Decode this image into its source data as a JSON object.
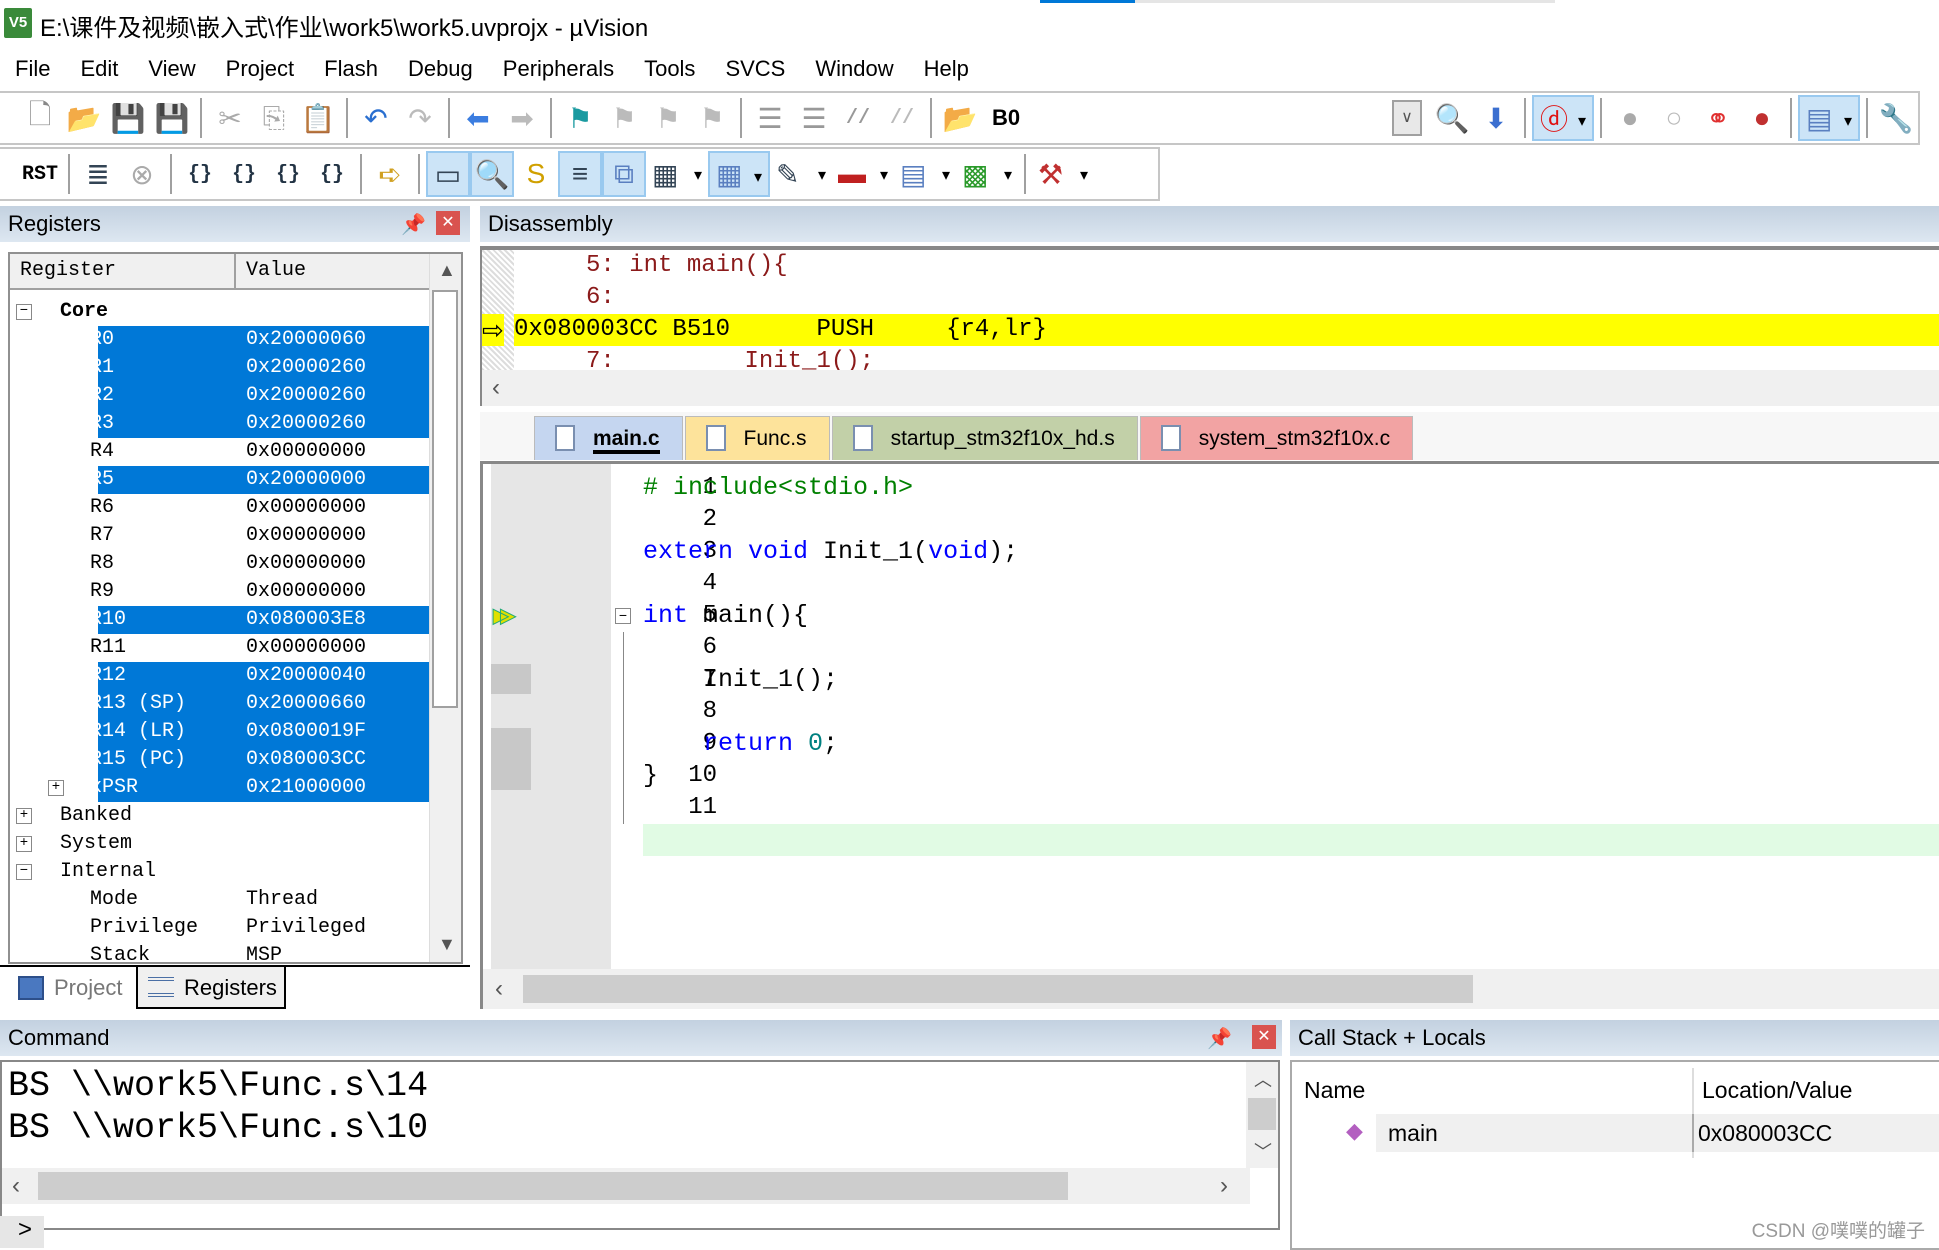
{
  "window": {
    "title": "E:\\课件及视频\\嵌入式\\作业\\work5\\work5.uvprojx - µVision",
    "logo_text": "V5"
  },
  "menu": [
    "File",
    "Edit",
    "View",
    "Project",
    "Flash",
    "Debug",
    "Peripherals",
    "Tools",
    "SVCS",
    "Window",
    "Help"
  ],
  "toolbar1": {
    "groups": [
      [
        "new-file",
        "open-file",
        "save",
        "save-all"
      ],
      [
        "cut",
        "copy",
        "paste"
      ],
      [
        "undo",
        "redo"
      ],
      [
        "navigate-back",
        "navigate-forward"
      ],
      [
        "bookmark",
        "prev-bookmark",
        "next-bookmark",
        "clear-bookmarks"
      ],
      [
        "indent",
        "unindent",
        "comment",
        "uncomment"
      ],
      [
        "find-in-files"
      ]
    ],
    "target_text": "B0",
    "right_groups": [
      [
        "find",
        "incremental-find"
      ],
      [
        "start-debug*"
      ],
      [
        "insert-breakpoint",
        "enable-breakpoint",
        "disable-breakpoints",
        "kill-breakpoints"
      ],
      [
        "window-layout*"
      ],
      [
        "configure"
      ]
    ]
  },
  "toolbar2": {
    "groups": [
      [
        "reset"
      ],
      [
        "run",
        "stop"
      ],
      [
        "step-into",
        "step-over",
        "step-out",
        "run-to-cursor"
      ],
      [
        "show-next-statement"
      ],
      [
        "command-window!",
        "disassembly-window!",
        "symbols-window",
        "registers-window!",
        "call-stack-window!",
        "watch-window>",
        "memory-window!>",
        "serial-window>",
        "analysis-window>",
        "trace-window>",
        "system-viewer>"
      ],
      [
        "toolbox>"
      ]
    ]
  },
  "registers": {
    "title": "Registers",
    "columns": [
      "Register",
      "Value"
    ],
    "rows": [
      {
        "name": "Core",
        "value": "",
        "level": 0,
        "expander": "−",
        "bold": true
      },
      {
        "name": "R0",
        "value": "0x20000060",
        "level": 1,
        "hl": true
      },
      {
        "name": "R1",
        "value": "0x20000260",
        "level": 1,
        "hl": true
      },
      {
        "name": "R2",
        "value": "0x20000260",
        "level": 1,
        "hl": true
      },
      {
        "name": "R3",
        "value": "0x20000260",
        "level": 1,
        "hl": true
      },
      {
        "name": "R4",
        "value": "0x00000000",
        "level": 1
      },
      {
        "name": "R5",
        "value": "0x20000000",
        "level": 1,
        "hl": true
      },
      {
        "name": "R6",
        "value": "0x00000000",
        "level": 1
      },
      {
        "name": "R7",
        "value": "0x00000000",
        "level": 1
      },
      {
        "name": "R8",
        "value": "0x00000000",
        "level": 1
      },
      {
        "name": "R9",
        "value": "0x00000000",
        "level": 1
      },
      {
        "name": "R10",
        "value": "0x080003E8",
        "level": 1,
        "hl": true
      },
      {
        "name": "R11",
        "value": "0x00000000",
        "level": 1
      },
      {
        "name": "R12",
        "value": "0x20000040",
        "level": 1,
        "hl": true
      },
      {
        "name": "R13 (SP)",
        "value": "0x20000660",
        "level": 1,
        "hl": true
      },
      {
        "name": "R14 (LR)",
        "value": "0x0800019F",
        "level": 1,
        "hl": true
      },
      {
        "name": "R15 (PC)",
        "value": "0x080003CC",
        "level": 1,
        "hl": true
      },
      {
        "name": "xPSR",
        "value": "0x21000000",
        "level": 1,
        "hl": true,
        "expander": "+"
      },
      {
        "name": "Banked",
        "value": "",
        "level": 0,
        "expander": "+"
      },
      {
        "name": "System",
        "value": "",
        "level": 0,
        "expander": "+"
      },
      {
        "name": "Internal",
        "value": "",
        "level": 0,
        "expander": "−"
      },
      {
        "name": "Mode",
        "value": "Thread",
        "level": 1
      },
      {
        "name": "Privilege",
        "value": "Privileged",
        "level": 1
      },
      {
        "name": "Stack",
        "value": "MSP",
        "level": 1
      }
    ],
    "tabs": [
      "Project",
      "Registers"
    ],
    "active_tab": "Registers"
  },
  "disassembly": {
    "title": "Disassembly",
    "lines": [
      {
        "text": "     5: int main(){",
        "current": false
      },
      {
        "text": "     6: ",
        "current": false
      },
      {
        "text": "0x080003CC B510      PUSH     {r4,lr}",
        "current": true
      },
      {
        "text": "     7:         Init_1();",
        "current": false
      }
    ]
  },
  "editor": {
    "tabs": [
      {
        "label": "main.c",
        "color": "#c5d6f0",
        "active": true
      },
      {
        "label": "Func.s",
        "color": "#fde39b"
      },
      {
        "label": "startup_stm32f10x_hd.s",
        "color": "#c2d0a8"
      },
      {
        "label": "system_stm32f10x.c",
        "color": "#f2a3a3"
      }
    ],
    "current_line": 5,
    "cursor_line": 12,
    "lines": [
      [
        {
          "t": "# include<stdio.h>",
          "c": "pp"
        }
      ],
      [],
      [
        {
          "t": "extern void ",
          "c": "kw"
        },
        {
          "t": "Init_1(",
          "c": "pl"
        },
        {
          "t": "void",
          "c": "kw"
        },
        {
          "t": ");",
          "c": "pl"
        }
      ],
      [],
      [
        {
          "t": "int ",
          "c": "kw"
        },
        {
          "t": "main(){",
          "c": "pl"
        }
      ],
      [],
      [
        {
          "t": "    Init_1();",
          "c": "pl"
        }
      ],
      [],
      [
        {
          "t": "    return ",
          "c": "kw"
        },
        {
          "t": "0",
          "c": "num"
        },
        {
          "t": ";",
          "c": "pl"
        }
      ],
      [
        {
          "t": "}",
          "c": "pl"
        }
      ],
      [],
      []
    ]
  },
  "command": {
    "title": "Command",
    "lines": [
      "BS \\\\work5\\Func.s\\14",
      "BS \\\\work5\\Func.s\\10"
    ],
    "prompt": ">"
  },
  "callstack": {
    "title": "Call Stack + Locals",
    "columns": [
      "Name",
      "Location/Value"
    ],
    "rows": [
      {
        "name": "main",
        "value": "0x080003CC"
      }
    ]
  },
  "watermark": "CSDN @噗噗的罐子"
}
